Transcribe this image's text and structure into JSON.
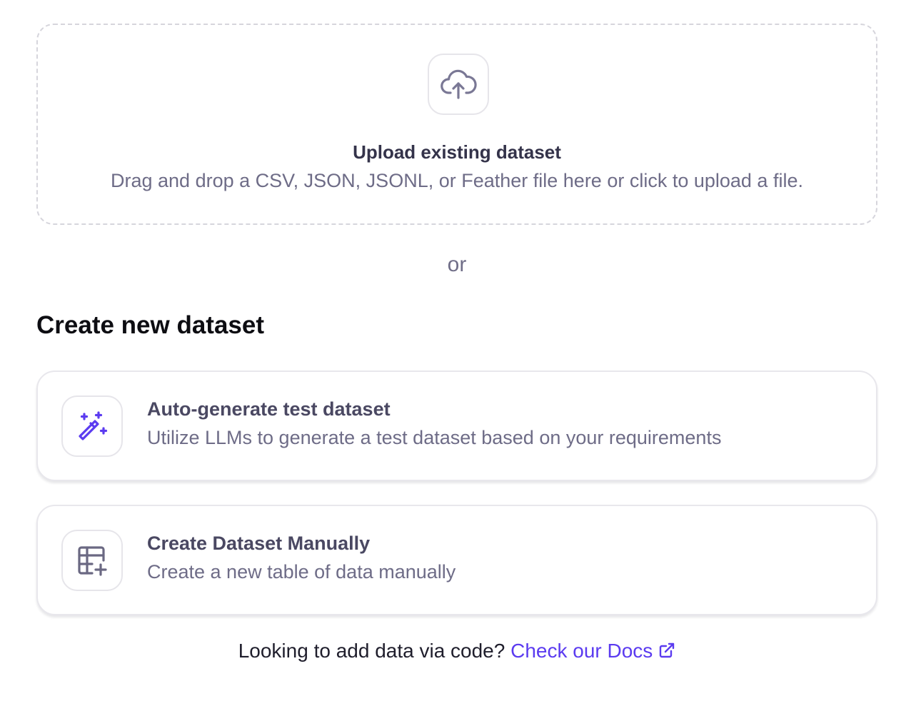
{
  "upload": {
    "title": "Upload existing dataset",
    "description": "Drag and drop a CSV, JSON, JSONL, or Feather file here or click to upload a file.",
    "icon": "cloud-upload-icon"
  },
  "divider": {
    "or_label": "or"
  },
  "create_section": {
    "title": "Create new dataset",
    "options": [
      {
        "title": "Auto-generate test dataset",
        "description": "Utilize LLMs to generate a test dataset based on your requirements",
        "icon": "magic-wand-icon"
      },
      {
        "title": "Create Dataset Manually",
        "description": "Create a new table of data manually",
        "icon": "table-add-icon"
      }
    ]
  },
  "footer": {
    "prompt": "Looking to add data via code?",
    "link_label": "Check our Docs",
    "link_icon": "external-link-icon"
  },
  "colors": {
    "accent": "#5b3bf0",
    "muted_text": "#6e6c87",
    "border": "#e8e7ec"
  }
}
